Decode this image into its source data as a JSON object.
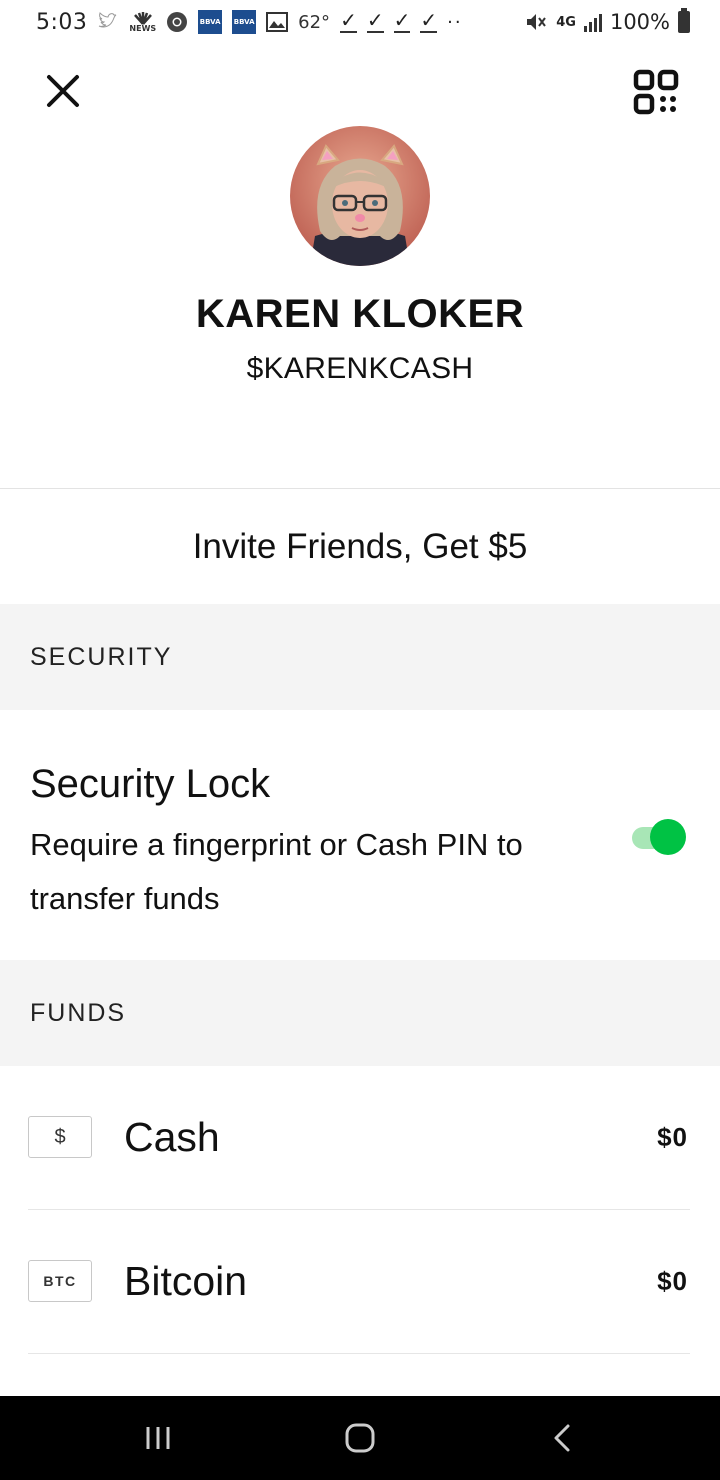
{
  "status_bar": {
    "time": "5:03",
    "news_label": "NEWS",
    "bbva_label": "BBVA",
    "temperature": "62°",
    "network": "4G",
    "battery_percent": "100%",
    "icons": [
      "twitter-icon",
      "nbc-news-icon",
      "chrome-icon",
      "bbva-icon",
      "bbva-icon",
      "gallery-icon",
      "check-icon",
      "check-icon",
      "check-icon",
      "check-icon",
      "more-dots-icon",
      "mute-icon",
      "network-icon",
      "signal-icon",
      "battery-icon"
    ]
  },
  "header": {
    "close_icon": "close-icon",
    "qr_icon": "qr-code-icon"
  },
  "profile": {
    "name": "KAREN KLOKER",
    "cashtag": "$KARENKCASH"
  },
  "invite": {
    "label": "Invite Friends, Get $5"
  },
  "security": {
    "section_label": "SECURITY",
    "title": "Security Lock",
    "description": "Require a fingerprint or Cash PIN to transfer funds",
    "enabled": true,
    "accent_color": "#00c244"
  },
  "funds": {
    "section_label": "FUNDS",
    "items": [
      {
        "badge": "$",
        "label": "Cash",
        "amount": "$0"
      },
      {
        "badge": "BTC",
        "label": "Bitcoin",
        "amount": "$0"
      }
    ]
  },
  "nav": {
    "recents_icon": "recents-icon",
    "home_icon": "home-icon",
    "back_icon": "back-icon"
  }
}
